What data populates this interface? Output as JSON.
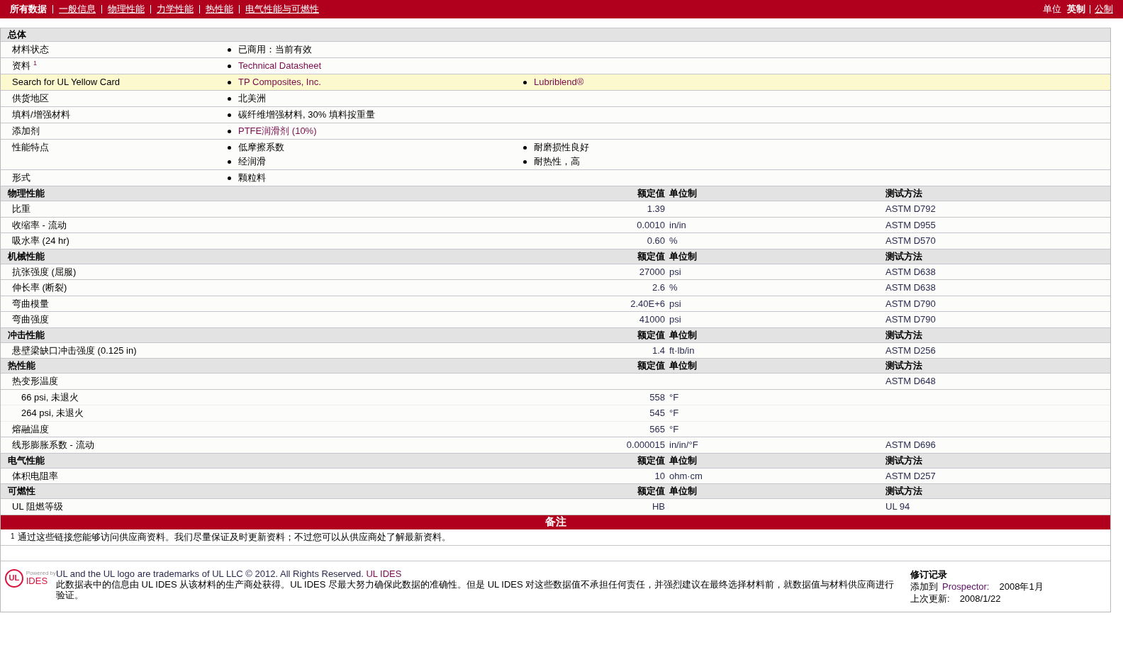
{
  "nav": {
    "tabs": [
      {
        "label": "所有数据",
        "selected": true
      },
      {
        "label": "一般信息",
        "selected": false
      },
      {
        "label": "物理性能",
        "selected": false
      },
      {
        "label": "力学性能",
        "selected": false
      },
      {
        "label": "热性能",
        "selected": false
      },
      {
        "label": "电气性能与可燃性",
        "selected": false
      }
    ],
    "units": {
      "label": "单位",
      "options": [
        {
          "label": "英制",
          "selected": true
        },
        {
          "label": "公制",
          "selected": false
        }
      ]
    }
  },
  "general": {
    "title": "总体",
    "rows": [
      {
        "label": "材料状态",
        "highlighted": false,
        "columns": [
          [
            {
              "text": "已商用：当前有效",
              "link": false
            }
          ]
        ]
      },
      {
        "label": "资料",
        "sup": "1",
        "highlighted": false,
        "columns": [
          [
            {
              "text": "Technical Datasheet",
              "link": true
            }
          ]
        ]
      },
      {
        "label": "Search for UL Yellow Card",
        "highlighted": true,
        "columns": [
          [
            {
              "text": "TP Composites, Inc.",
              "link": true
            }
          ],
          [
            {
              "text": "Lubriblend®",
              "link": true
            }
          ]
        ]
      },
      {
        "label": "供货地区",
        "highlighted": false,
        "columns": [
          [
            {
              "text": "北美洲",
              "link": false
            }
          ]
        ]
      },
      {
        "label": "填料/增强材料",
        "highlighted": false,
        "columns": [
          [
            {
              "text": "碳纤维增强材料, 30% 填料按重量",
              "link": false
            }
          ]
        ]
      },
      {
        "label": "添加剂",
        "highlighted": false,
        "columns": [
          [
            {
              "text": "PTFE润滑剂 (10%)",
              "link": true
            }
          ]
        ]
      },
      {
        "label": "性能特点",
        "highlighted": false,
        "columns": [
          [
            {
              "text": "低摩擦系数",
              "link": false
            },
            {
              "text": "经润滑",
              "link": false
            }
          ],
          [
            {
              "text": "耐磨损性良好",
              "link": false
            },
            {
              "text": "耐热性，高",
              "link": false
            }
          ]
        ]
      },
      {
        "label": "形式",
        "highlighted": false,
        "columns": [
          [
            {
              "text": "颗粒料",
              "link": false
            }
          ]
        ]
      }
    ]
  },
  "sections": [
    {
      "title": "物理性能",
      "value_header": "额定值",
      "unit_header": "单位制",
      "method_header": "测试方法",
      "rows": [
        {
          "label": "比重",
          "value": "1.39",
          "method": "ASTM D792"
        },
        {
          "label": "收缩率 - 流动",
          "value": "0.0010",
          "unit": "in/in",
          "method": "ASTM D955"
        },
        {
          "label": "吸水率 (24 hr)",
          "value": "0.60",
          "unit": "%",
          "method": "ASTM D570"
        }
      ]
    },
    {
      "title": "机械性能",
      "value_header": "额定值",
      "unit_header": "单位制",
      "method_header": "测试方法",
      "rows": [
        {
          "label": "抗张强度 (屈服)",
          "value": "27000",
          "unit": "psi",
          "method": "ASTM D638"
        },
        {
          "label": "伸长率 (断裂)",
          "value": "2.6",
          "unit": "%",
          "method": "ASTM D638"
        },
        {
          "label": "弯曲模量",
          "value": "2.40E+6",
          "unit": "psi",
          "method": "ASTM D790"
        },
        {
          "label": "弯曲强度",
          "value": "41000",
          "unit": "psi",
          "method": "ASTM D790"
        }
      ]
    },
    {
      "title": "冲击性能",
      "value_header": "额定值",
      "unit_header": "单位制",
      "method_header": "测试方法",
      "rows": [
        {
          "label": "悬壁梁缺口冲击强度 (0.125 in)",
          "value": "1.4",
          "unit": "ft·lb/in",
          "method": "ASTM D256"
        }
      ]
    },
    {
      "title": "热性能",
      "value_header": "额定值",
      "unit_header": "单位制",
      "method_header": "测试方法",
      "rows": [
        {
          "label": "热变形温度",
          "method": "ASTM D648",
          "children": [
            {
              "label": "66 psi, 未退火",
              "value": "558",
              "unit": "°F"
            },
            {
              "label": "264 psi, 未退火",
              "value": "545",
              "unit": "°F"
            }
          ]
        },
        {
          "label": "熔融温度",
          "value": "565",
          "unit": "°F"
        },
        {
          "label": "线形膨胀系数 - 流动",
          "value": "0.000015",
          "unit": "in/in/°F",
          "method": "ASTM D696"
        }
      ]
    },
    {
      "title": "电气性能",
      "value_header": "额定值",
      "unit_header": "单位制",
      "method_header": "测试方法",
      "rows": [
        {
          "label": "体积电阻率",
          "value": "10",
          "unit": "ohm·cm",
          "method": "ASTM D257"
        }
      ]
    },
    {
      "title": "可燃性",
      "value_header": "额定值",
      "unit_header": "单位制",
      "method_header": "测试方法",
      "rows": [
        {
          "label": "UL 阻燃等级",
          "value": "HB",
          "method": "UL 94"
        }
      ]
    }
  ],
  "notes": {
    "title": "备注",
    "items": [
      {
        "mark": "1",
        "text": "通过这些链接您能够访问供应商资料。我们尽量保证及时更新资料；不过您可以从供应商处了解最新资料。"
      }
    ]
  },
  "footer": {
    "logo": {
      "mark": "UL",
      "powered_by": "Powered by",
      "name": "IDES"
    },
    "trademark": "UL and the UL logo are trademarks of UL LLC © 2012. All Rights Reserved.",
    "trademark_link": "UL IDES",
    "disclaimer": "此数据表中的信息由 UL IDES 从该材料的生产商处获得。UL IDES 尽最大努力确保此数据的准确性。但是 UL IDES 对这些数据值不承担任何责任，并强烈建议在最终选择材料前，就数据值与材料供应商进行验证。",
    "revision": {
      "title": "修订记录",
      "added_label": "添加到",
      "added_link": "Prospector:",
      "added_date": "2008年1月",
      "updated_label": "上次更新:",
      "updated_date": "2008/1/22"
    }
  }
}
